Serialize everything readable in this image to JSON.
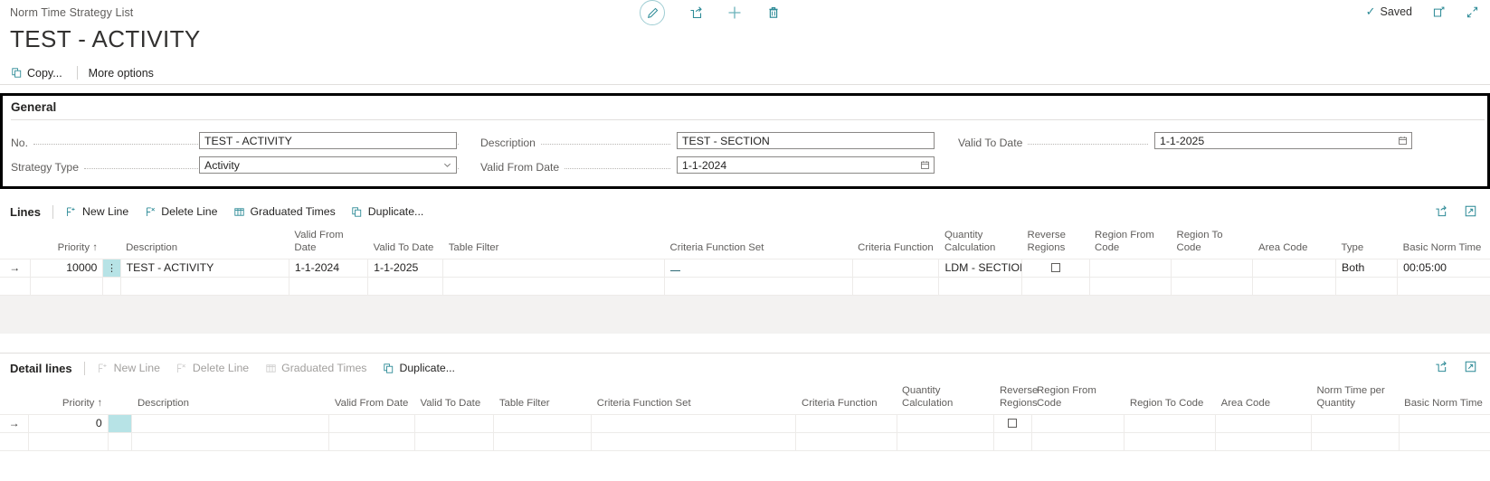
{
  "topbar": {
    "breadcrumb": "Norm Time Strategy List",
    "saved_label": "Saved",
    "icons": {
      "edit": "edit-pencil-icon",
      "share": "share-icon",
      "new": "plus-icon",
      "delete": "trash-icon",
      "open_new_window": "open-in-new-window-icon",
      "collapse": "collapse-icon"
    }
  },
  "page": {
    "title": "TEST - ACTIVITY"
  },
  "ribbon": {
    "copy_label": "Copy...",
    "more_options_label": "More options"
  },
  "general": {
    "title": "General",
    "fields": {
      "no": {
        "label": "No.",
        "value": "TEST - ACTIVITY"
      },
      "strategy_type": {
        "label": "Strategy Type",
        "value": "Activity"
      },
      "description": {
        "label": "Description",
        "value": "TEST - SECTION"
      },
      "valid_from_date": {
        "label": "Valid From Date",
        "value": "1-1-2024"
      },
      "valid_to_date": {
        "label": "Valid To Date",
        "value": "1-1-2025"
      }
    }
  },
  "lines": {
    "title": "Lines",
    "actions": {
      "new_line": "New Line",
      "delete_line": "Delete Line",
      "graduated_times": "Graduated Times",
      "duplicate": "Duplicate..."
    },
    "columns": [
      "Priority ↑",
      "Description",
      "Valid From Date",
      "Valid To Date",
      "Table Filter",
      "Criteria Function Set",
      "Criteria Function",
      "Quantity Calculation",
      "Reverse Regions",
      "Region From Code",
      "Region To Code",
      "Area Code",
      "Type",
      "Basic Norm Time"
    ],
    "rows": [
      {
        "priority": "10000",
        "description": "TEST - ACTIVITY",
        "valid_from_date": "1-1-2024",
        "valid_to_date": "1-1-2025",
        "table_filter": "",
        "criteria_function_set": "_",
        "criteria_function": "",
        "quantity_calculation": "LDM - SECTION",
        "reverse_regions": false,
        "region_from_code": "",
        "region_to_code": "",
        "area_code": "",
        "type": "Both",
        "basic_norm_time": "00:05:00"
      },
      {
        "priority": "",
        "description": "",
        "valid_from_date": "",
        "valid_to_date": "",
        "table_filter": "",
        "criteria_function_set": "",
        "criteria_function": "",
        "quantity_calculation": "",
        "reverse_regions": null,
        "region_from_code": "",
        "region_to_code": "",
        "area_code": "",
        "type": "",
        "basic_norm_time": ""
      }
    ]
  },
  "detail_lines": {
    "title": "Detail lines",
    "actions": {
      "new_line": "New Line",
      "delete_line": "Delete Line",
      "graduated_times": "Graduated Times",
      "duplicate": "Duplicate..."
    },
    "columns": [
      "Priority ↑",
      "Description",
      "Valid From Date",
      "Valid To Date",
      "Table Filter",
      "Criteria Function Set",
      "Criteria Function",
      "Quantity Calculation",
      "Reverse Regions",
      "Region From Code",
      "Region To Code",
      "Area Code",
      "Norm Time per Quantity",
      "Basic Norm Time"
    ],
    "rows": [
      {
        "priority": "0",
        "description": "",
        "valid_from_date": "",
        "valid_to_date": "",
        "table_filter": "",
        "criteria_function_set": "",
        "criteria_function": "",
        "quantity_calculation": "",
        "reverse_regions": false,
        "region_from_code": "",
        "region_to_code": "",
        "area_code": "",
        "norm_time_per_quantity": "",
        "basic_norm_time": ""
      },
      {
        "priority": "",
        "description": "",
        "valid_from_date": "",
        "valid_to_date": "",
        "table_filter": "",
        "criteria_function_set": "",
        "criteria_function": "",
        "quantity_calculation": "",
        "reverse_regions": null,
        "region_from_code": "",
        "region_to_code": "",
        "area_code": "",
        "norm_time_per_quantity": "",
        "basic_norm_time": ""
      }
    ]
  },
  "colors": {
    "accent": "#2e8b97",
    "selection": "#b7e3e6",
    "text": "#252423",
    "muted": "#605e5c"
  }
}
